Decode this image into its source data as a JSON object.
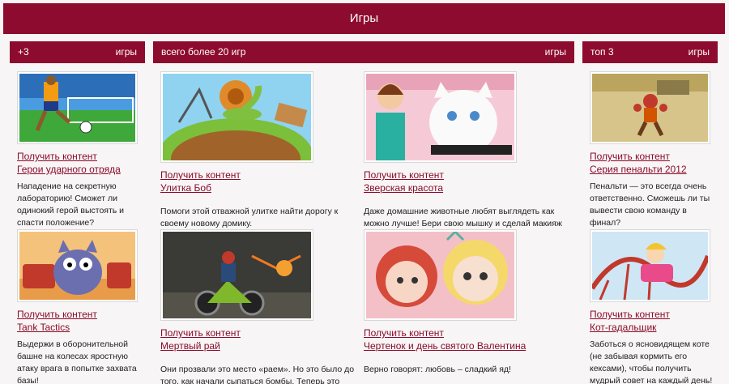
{
  "header": {
    "title": "Игры"
  },
  "columns": [
    {
      "left": "+3",
      "right": "игры"
    },
    {
      "left": "всего более 20 игр",
      "right": "игры"
    },
    {
      "left": "топ 3",
      "right": "игры"
    }
  ],
  "cards": {
    "c1": {
      "link": "Получить контент",
      "title": "Герои ударного отряда",
      "desc": "Нападение на секретную лабораторию! Сможет ли одинокий герой выстоять и спасти положение?"
    },
    "c2": {
      "link": "Получить контент",
      "title": "Tank Tactics",
      "desc": "Выдержи в оборонительной башне на колесах яростную атаку врага в попытке захвата базы!"
    },
    "c3": {
      "link": "Получить контент",
      "title": "Улитка Боб",
      "desc": "Помоги этой отважной улитке найти дорогу к своему новому домику."
    },
    "c4": {
      "link": "Получить контент",
      "title": "Мертвый рай",
      "desc": "Они прозвали это место «раем». Но это было до того, как начали сыпаться бомбы. Теперь это"
    },
    "c5": {
      "link": "Получить контент",
      "title": "Зверская красота",
      "desc": "Даже домашние животные любят выглядеть как можно лучше! Бери свою мышку и сделай макияж этим питомцам"
    },
    "c6": {
      "link": "Получить контент",
      "title": "Чертенок и день святого Валентина",
      "desc": "Верно говорят: любовь – сладкий яд!"
    },
    "c7": {
      "link": "Получить контент",
      "title": "Серия пенальти 2012",
      "desc": "Пенальти — это всегда очень ответственно. Сможешь ли ты вывести свою команду в финал?"
    },
    "c8": {
      "link": "Получить контент",
      "title": "Кот-гадальщик",
      "desc": "Заботься о ясновидящем коте (не забывая кормить его кексами), чтобы получить мудрый совет на каждый день!"
    }
  },
  "thumbs": {
    "c1": "soccer-player-image",
    "c2": "cat-tank-image",
    "c3": "snail-image",
    "c4": "motorbike-image",
    "c5": "girl-and-cat-image",
    "c6": "girls-valentine-image",
    "c7": "boxer-image",
    "c8": "rollercoaster-image"
  },
  "colors": {
    "brand": "#8d0b2e",
    "link": "#8a0b2a"
  }
}
